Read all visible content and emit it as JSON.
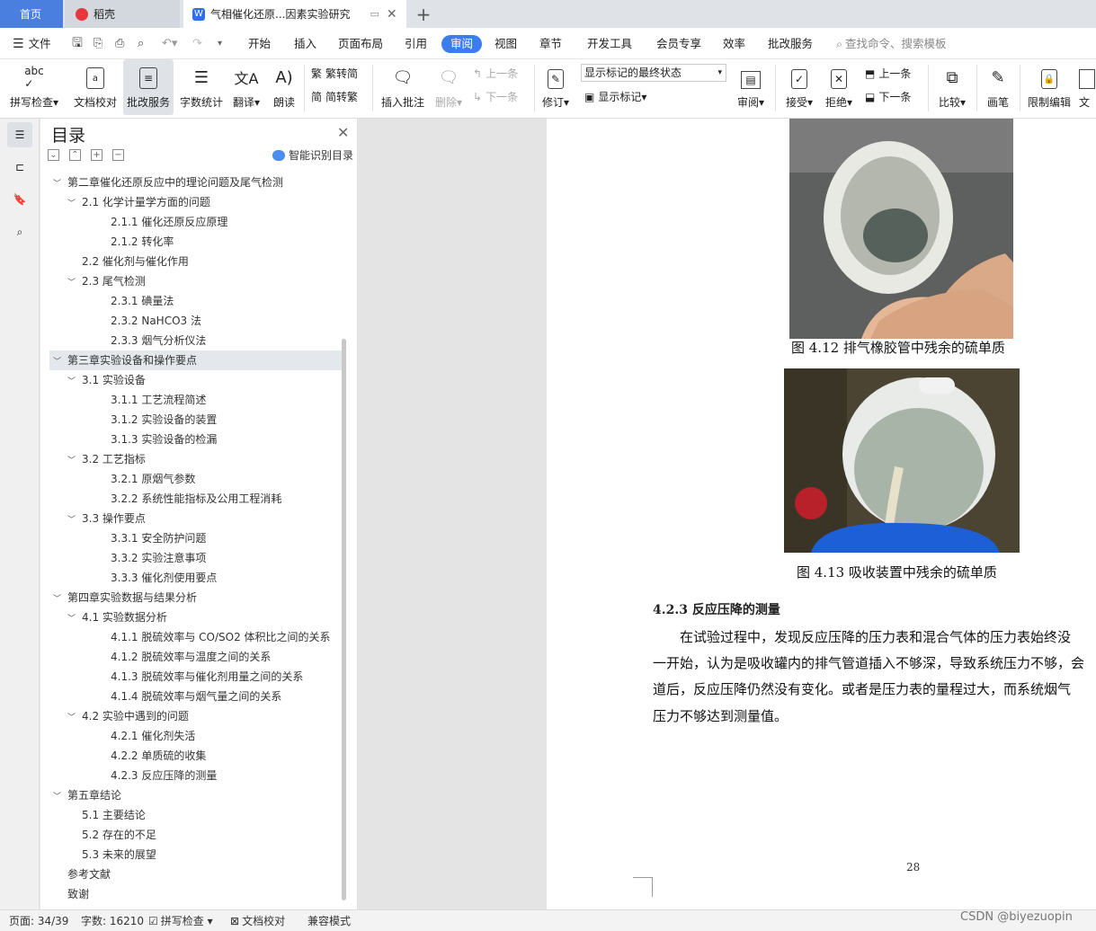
{
  "tabs": {
    "home": "首页",
    "daoke": "稻壳",
    "doc": "气相催化还原...因素实验研究"
  },
  "menu": [
    "文件",
    "开始",
    "插入",
    "页面布局",
    "引用",
    "审阅",
    "视图",
    "章节",
    "开发工具",
    "会员专享",
    "效率",
    "批改服务"
  ],
  "search_placeholder": "查找命令、搜索模板",
  "ribbon": {
    "spell": "拼写检查",
    "proof": "文档校对",
    "correct": "批改服务",
    "wordcount": "字数统计",
    "translate": "翻译",
    "read": "朗读",
    "t2s": "繁转简",
    "s2t": "简转繁",
    "insert_comment": "插入批注",
    "delete": "删除",
    "prev": "上一条",
    "next": "下一条",
    "revise": "修订",
    "markup_state": "显示标记的最终状态",
    "show_markup": "显示标记",
    "review": "审阅",
    "accept": "接受",
    "reject": "拒绝",
    "prev2": "上一条",
    "next2": "下一条",
    "compare": "比较",
    "pen": "画笔",
    "restrict": "限制编辑",
    "doc_cut": "文"
  },
  "toc": {
    "title": "目录",
    "smart": "智能识别目录",
    "items": [
      {
        "level": 0,
        "arrow": "﹀",
        "text": "第二章催化还原反应中的理论问题及尾气检测"
      },
      {
        "level": 1,
        "arrow": "﹀",
        "text": "2.1  化学计量学方面的问题"
      },
      {
        "level": 2,
        "arrow": "",
        "text": "2.1.1  催化还原反应原理"
      },
      {
        "level": 2,
        "arrow": "",
        "text": "2.1.2  转化率"
      },
      {
        "level": 1,
        "arrow": "",
        "text": "2.2 催化剂与催化作用"
      },
      {
        "level": 1,
        "arrow": "﹀",
        "text": "2.3  尾气检测"
      },
      {
        "level": 2,
        "arrow": "",
        "text": "2.3.1  碘量法"
      },
      {
        "level": 2,
        "arrow": "",
        "text": "2.3.2 NaHCO3 法"
      },
      {
        "level": 2,
        "arrow": "",
        "text": "2.3.3  烟气分析仪法"
      },
      {
        "level": 0,
        "arrow": "﹀",
        "text": "第三章实验设备和操作要点",
        "selected": true
      },
      {
        "level": 1,
        "arrow": "﹀",
        "text": "3.1  实验设备"
      },
      {
        "level": 2,
        "arrow": "",
        "text": "3.1.1  工艺流程简述"
      },
      {
        "level": 2,
        "arrow": "",
        "text": "3.1.2  实验设备的装置"
      },
      {
        "level": 2,
        "arrow": "",
        "text": "3.1.3  实验设备的检漏"
      },
      {
        "level": 1,
        "arrow": "﹀",
        "text": "3.2  工艺指标"
      },
      {
        "level": 2,
        "arrow": "",
        "text": "3.2.1  原烟气参数"
      },
      {
        "level": 2,
        "arrow": "",
        "text": "3.2.2  系统性能指标及公用工程消耗"
      },
      {
        "level": 1,
        "arrow": "﹀",
        "text": "3.3  操作要点"
      },
      {
        "level": 2,
        "arrow": "",
        "text": "3.3.1  安全防护问题"
      },
      {
        "level": 2,
        "arrow": "",
        "text": "3.3.2  实验注意事项"
      },
      {
        "level": 2,
        "arrow": "",
        "text": "3.3.3  催化剂使用要点"
      },
      {
        "level": 0,
        "arrow": "﹀",
        "text": "第四章实验数据与结果分析"
      },
      {
        "level": 1,
        "arrow": "﹀",
        "text": "4.1  实验数据分析"
      },
      {
        "level": 2,
        "arrow": "",
        "text": "4.1.1  脱硫效率与 CO/SO2 体积比之间的关系"
      },
      {
        "level": 2,
        "arrow": "",
        "text": "4.1.2  脱硫效率与温度之间的关系"
      },
      {
        "level": 2,
        "arrow": "",
        "text": "4.1.3  脱硫效率与催化剂用量之间的关系"
      },
      {
        "level": 2,
        "arrow": "",
        "text": "4.1.4  脱硫效率与烟气量之间的关系"
      },
      {
        "level": 1,
        "arrow": "﹀",
        "text": "4.2  实验中遇到的问题"
      },
      {
        "level": 2,
        "arrow": "",
        "text": "4.2.1  催化剂失活"
      },
      {
        "level": 2,
        "arrow": "",
        "text": "4.2.2  单质硫的收集"
      },
      {
        "level": 2,
        "arrow": "",
        "text": "4.2.3  反应压降的测量"
      },
      {
        "level": 0,
        "arrow": "﹀",
        "text": "第五章结论"
      },
      {
        "level": 1,
        "arrow": "",
        "text": "5.1  主要结论"
      },
      {
        "level": 1,
        "arrow": "",
        "text": "5.2  存在的不足"
      },
      {
        "level": 1,
        "arrow": "",
        "text": "5.3  未来的展望"
      },
      {
        "level": 0,
        "arrow": "",
        "text": "参考文献"
      },
      {
        "level": 0,
        "arrow": "",
        "text": "致谢"
      }
    ]
  },
  "document": {
    "fig1_caption": "图 4.12  排气橡胶管中残余的硫单质",
    "fig2_caption": "图 4.13  吸收装置中残余的硫单质",
    "section_heading": "4.2.3  反应压降的测量",
    "body_lines": [
      "　　在试验过程中，发现反应压降的压力表和混合气体的压力表始终没",
      "一开始，认为是吸收罐内的排气管道插入不够深，导致系统压力不够，会",
      "道后，反应压降仍然没有变化。或者是压力表的量程过大，而系统烟气",
      "压力不够达到测量值。"
    ],
    "page_number": "28"
  },
  "status": {
    "page": "页面: 34/39",
    "words": "字数: 16210",
    "spell": "拼写检查",
    "proof": "文档校对",
    "compat": "兼容模式",
    "watermark": "CSDN @biyezuopin"
  }
}
